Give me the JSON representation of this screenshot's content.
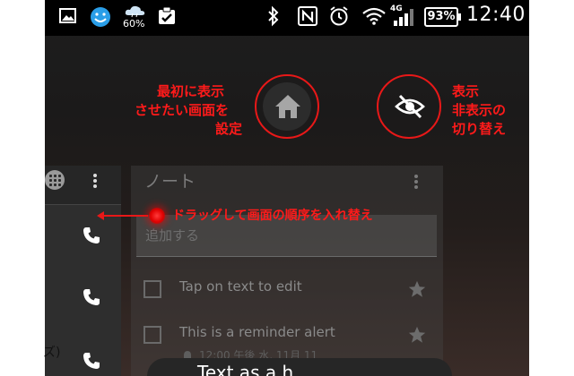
{
  "status_bar": {
    "weather_percent": "60%",
    "network_label": "4G",
    "battery": "93%",
    "time": "12:40"
  },
  "annotations": {
    "home_label_1": "最初に表示",
    "home_label_2": "させたい画面を",
    "home_label_3": "設定",
    "visibility_label_1": "表示",
    "visibility_label_2": "非表示の",
    "visibility_label_3": "切り替え",
    "drag_label": "ドラッグして画面の順序を入れ替え"
  },
  "note": {
    "title": "ノート",
    "add_placeholder": "追加する",
    "items": [
      {
        "text": "Tap on text to edit"
      },
      {
        "text": "This is a reminder alert"
      }
    ],
    "reminder": "12:00 午後 水, 11月 11",
    "fab_text": "Text as a h"
  },
  "outside": {
    "left_text": "ズ)"
  },
  "icons": {
    "home": "home-icon",
    "visibility_off": "eye-off-icon",
    "phone": "phone-icon",
    "star": "star-icon",
    "menu": "more-vert-icon"
  },
  "colors": {
    "annotation": "#e81818",
    "background": "#1e1e1e"
  }
}
